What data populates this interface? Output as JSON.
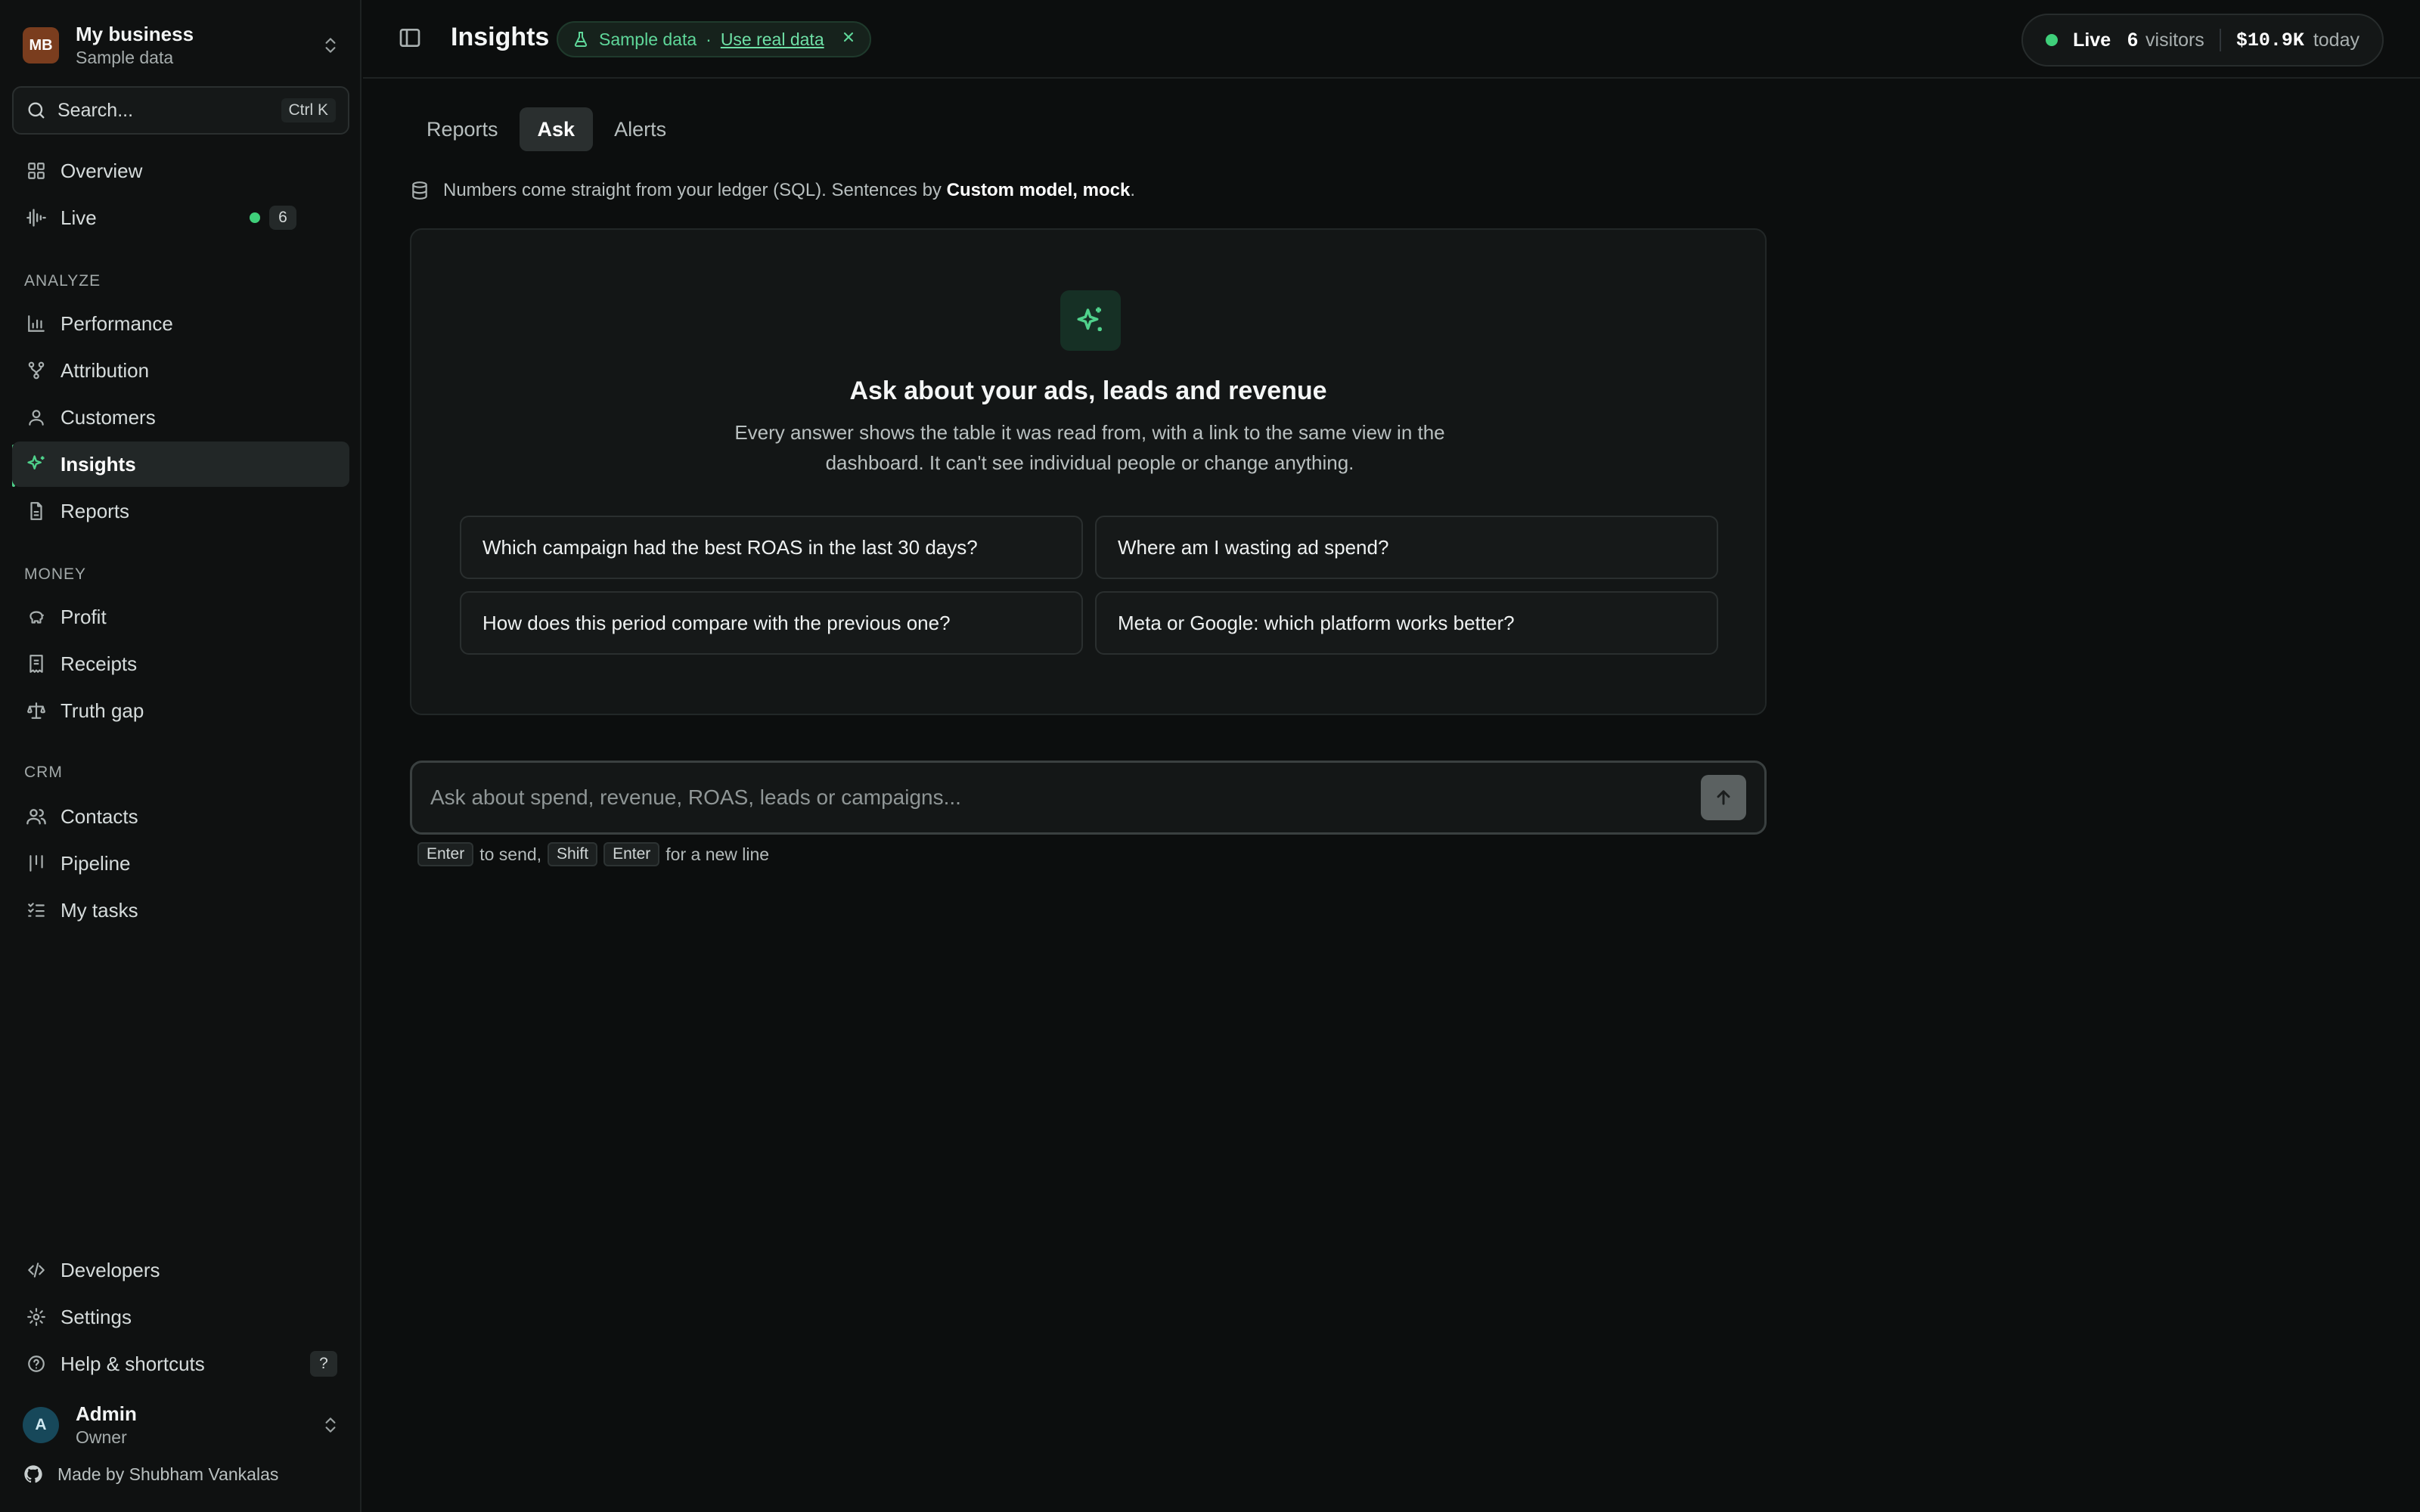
{
  "business": {
    "initials": "MB",
    "name": "My business",
    "subtitle": "Sample data"
  },
  "search": {
    "placeholder": "Search...",
    "shortcut": "Ctrl K"
  },
  "nav": {
    "overview": "Overview",
    "live": {
      "label": "Live",
      "count": "6"
    },
    "analyze_label": "ANALYZE",
    "performance": "Performance",
    "attribution": "Attribution",
    "customers": "Customers",
    "insights": "Insights",
    "reports": "Reports",
    "money_label": "MONEY",
    "profit": "Profit",
    "receipts": "Receipts",
    "truth_gap": "Truth gap",
    "crm_label": "CRM",
    "contacts": "Contacts",
    "pipeline": "Pipeline",
    "my_tasks": "My tasks",
    "developers": "Developers",
    "settings": "Settings",
    "help": "Help & shortcuts",
    "help_key": "?"
  },
  "user": {
    "initial": "A",
    "name": "Admin",
    "role": "Owner"
  },
  "footer": {
    "made_by": "Made by Shubham Vankalas"
  },
  "header": {
    "title": "Insights",
    "sample_label": "Sample data",
    "sample_separator": "·",
    "sample_link": "Use real data",
    "live_label": "Live",
    "visitors_count": "6",
    "visitors_label": "visitors",
    "revenue": "$10.9K",
    "revenue_label": "today"
  },
  "tabs": [
    "Reports",
    "Ask",
    "Alerts"
  ],
  "source_note": {
    "prefix": "Numbers come straight from your ledger (SQL). Sentences by ",
    "model": "Custom model, mock",
    "suffix": "."
  },
  "empty_state": {
    "title": "Ask about your ads, leads and revenue",
    "description": "Every answer shows the table it was read from, with a link to the same view in the dashboard. It can't see individual people or change anything.",
    "suggestions": [
      "Which campaign had the best ROAS in the last 30 days?",
      "Where am I wasting ad spend?",
      "How does this period compare with the previous one?",
      "Meta or Google: which platform works better?"
    ]
  },
  "composer": {
    "placeholder": "Ask about spend, revenue, ROAS, leads or campaigns...",
    "hint_enter": "Enter",
    "hint_send": "to send,",
    "hint_shift": "Shift",
    "hint_enter2": "Enter",
    "hint_newline": "for a new line"
  },
  "colors": {
    "accent": "#4fd18b",
    "background": "#0c0e0e",
    "live": "#3fcf7a"
  }
}
